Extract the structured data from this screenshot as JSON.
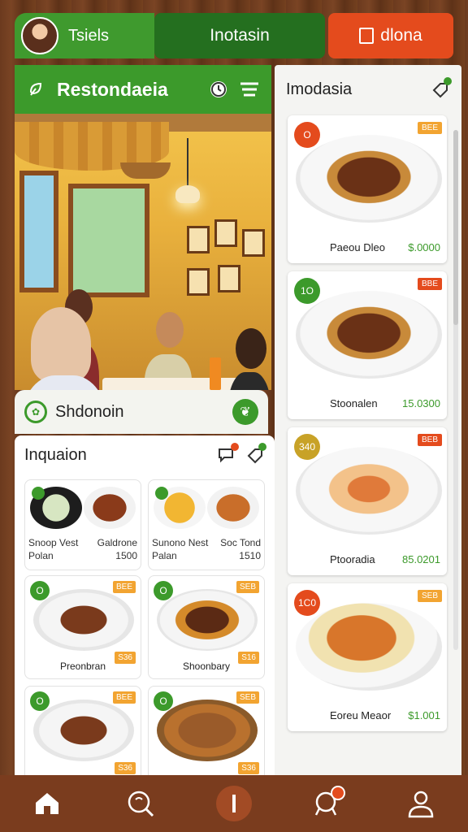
{
  "topbar": {
    "user_name": "Tsiels",
    "center_tab": "Inotasin",
    "right_tab": "dlona",
    "accent_green": "#3c9a2b",
    "accent_orange": "#e44b1d"
  },
  "left_panel": {
    "title": "Restondaeia",
    "icons": [
      "leaf-icon",
      "clock-icon",
      "menu-icon"
    ]
  },
  "special_bar": {
    "title": "Shdonoin"
  },
  "grid_panel": {
    "title": "Inquaion",
    "mini_cards": [
      {
        "name": "Snoop Vest",
        "sub": "Polan",
        "name2": "Galdrone",
        "sub2": "1500"
      },
      {
        "name": "Sunono Nest",
        "sub": "Palan",
        "name2": "Soc Tond",
        "sub2": "1510"
      }
    ],
    "dish_rows": [
      [
        {
          "name": "Preonbran",
          "badge": "O",
          "tag": "BEE",
          "price_tag": "S36"
        },
        {
          "name": "Shoonbary",
          "badge": "O",
          "tag": "SEB",
          "price_tag": "S16"
        }
      ],
      [
        {
          "name": "",
          "badge": "O",
          "tag": "BEE",
          "price_tag": "S36"
        },
        {
          "name": "",
          "badge": "O",
          "tag": "SEB",
          "price_tag": "S36"
        }
      ]
    ]
  },
  "right_panel": {
    "title": "Imodasia",
    "cards": [
      {
        "name": "Paeou Dleo",
        "price": "$.0000",
        "badge": "O",
        "badge_color": "#e44b1d",
        "tag": "BEE",
        "tag_color": "#f2a431"
      },
      {
        "name": "Stoonalen",
        "price": "15.0300",
        "badge": "1O",
        "badge_color": "#3c9a2b",
        "tag": "BBE",
        "tag_color": "#e44b1d"
      },
      {
        "name": "Ptooradia",
        "price": "85.0201",
        "badge": "340",
        "badge_color": "#c8a227",
        "tag": "BEB",
        "tag_color": "#e44b1d"
      },
      {
        "name": "Eoreu Meaor",
        "price": "$1.001",
        "badge": "1C0",
        "badge_color": "#e44b1d",
        "tag": "SEB",
        "tag_color": "#f2a431"
      }
    ]
  },
  "bottom_nav": {
    "items": [
      "home-icon",
      "search-icon",
      "center-action-icon",
      "notification-icon",
      "profile-icon"
    ]
  }
}
